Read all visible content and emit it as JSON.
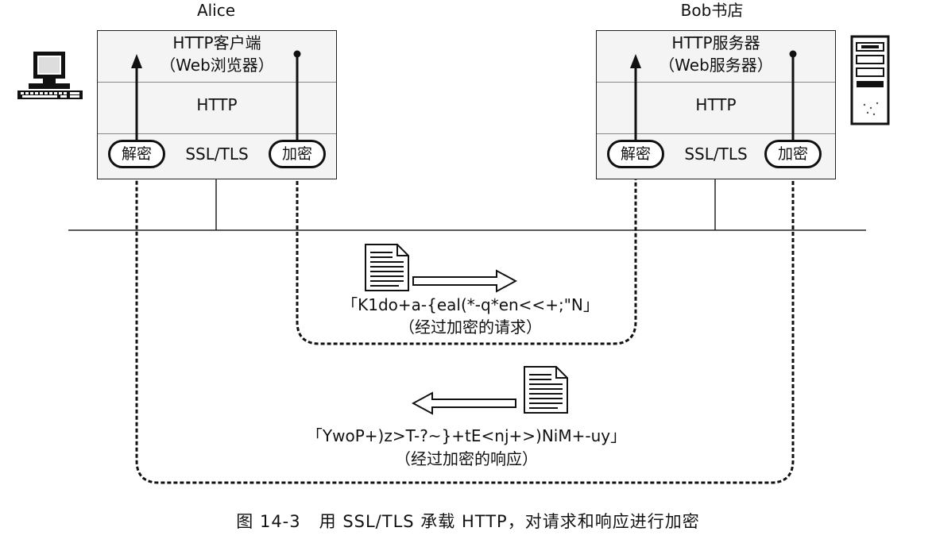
{
  "alice": {
    "name": "Alice",
    "app_line1": "HTTP客户端",
    "app_line2": "（Web浏览器）",
    "http": "HTTP",
    "ssl": "SSL/TLS",
    "decrypt": "解密",
    "encrypt": "加密",
    "computer_icon": "desktop-computer-icon"
  },
  "bob": {
    "name": "Bob书店",
    "app_line1": "HTTP服务器",
    "app_line2": "（Web服务器）",
    "http": "HTTP",
    "ssl": "SSL/TLS",
    "decrypt": "解密",
    "encrypt": "加密",
    "server_icon": "server-tower-icon"
  },
  "request": {
    "ciphertext": "「K1do+a-{eal(*-q*en<<+;\"N」",
    "desc": "（经过加密的请求）",
    "doc_icon": "document-icon",
    "arrow_icon": "arrow-right-icon"
  },
  "response": {
    "ciphertext": "「YwoP+)z>T-?~}+tE<nj+>)NiM+-uy」",
    "desc": "（经过加密的响应）",
    "doc_icon": "document-icon",
    "arrow_icon": "arrow-left-icon"
  },
  "caption": "图 14-3   用 SSL/TLS 承载 HTTP，对请求和响应进行加密"
}
